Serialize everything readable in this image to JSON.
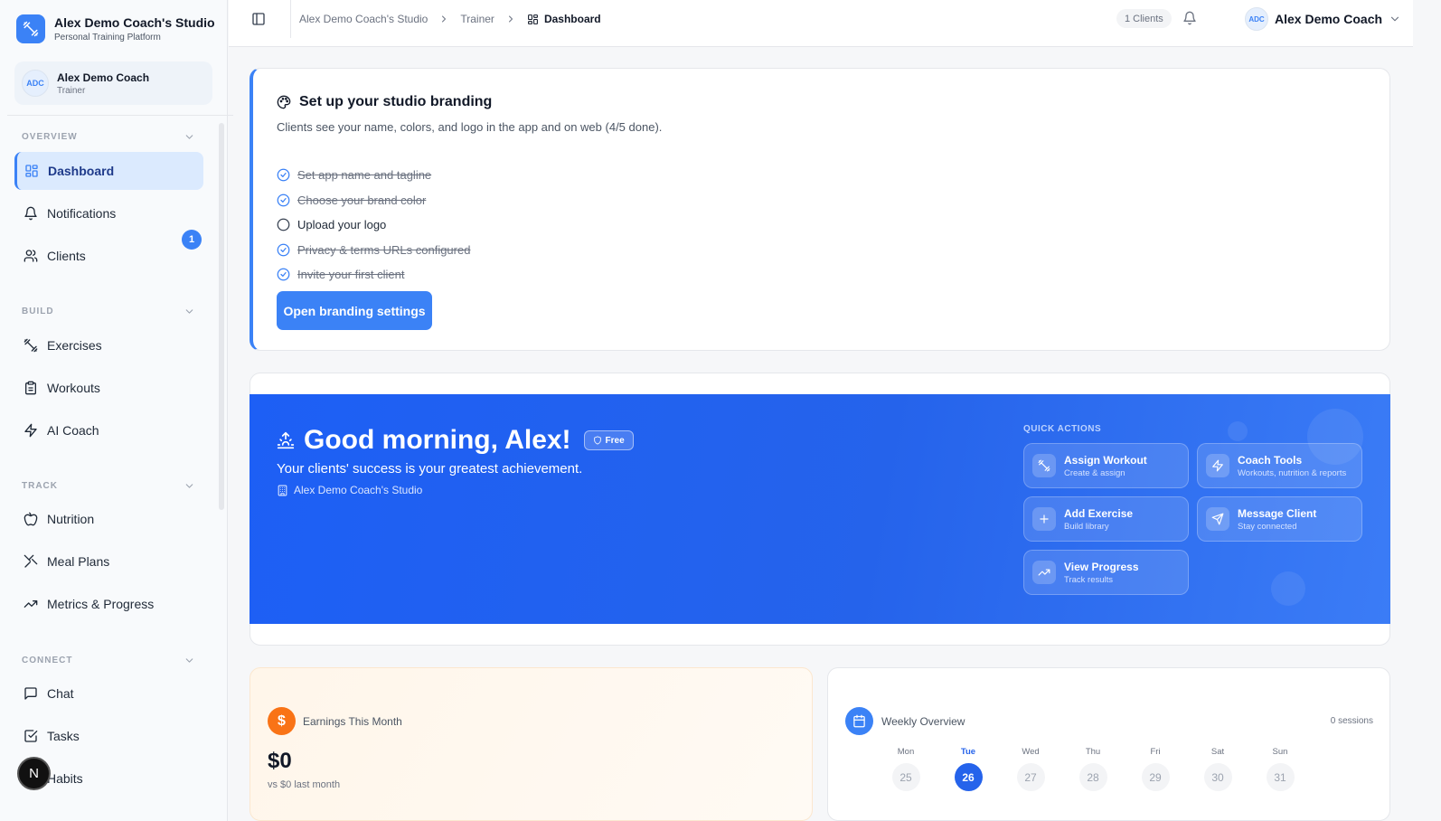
{
  "brand": {
    "title": "Alex Demo Coach's Studio",
    "subtitle": "Personal Training Platform"
  },
  "user": {
    "initials": "ADC",
    "name": "Alex Demo Coach",
    "role": "Trainer"
  },
  "sidebar": {
    "sections": [
      {
        "label": "OVERVIEW",
        "items": [
          {
            "label": "Dashboard",
            "icon": "grid-icon",
            "active": true
          },
          {
            "label": "Notifications",
            "icon": "bell-icon"
          },
          {
            "label": "Clients",
            "icon": "users-icon",
            "badge": "1"
          }
        ]
      },
      {
        "label": "BUILD",
        "items": [
          {
            "label": "Exercises",
            "icon": "dumbbell-icon"
          },
          {
            "label": "Workouts",
            "icon": "clipboard-icon"
          },
          {
            "label": "AI Coach",
            "icon": "bolt-icon"
          }
        ]
      },
      {
        "label": "TRACK",
        "items": [
          {
            "label": "Nutrition",
            "icon": "apple-icon"
          },
          {
            "label": "Meal Plans",
            "icon": "utensils-icon"
          },
          {
            "label": "Metrics & Progress",
            "icon": "trending-up-icon"
          }
        ]
      },
      {
        "label": "CONNECT",
        "items": [
          {
            "label": "Chat",
            "icon": "message-icon"
          },
          {
            "label": "Tasks",
            "icon": "checkbox-icon"
          },
          {
            "label": "Habits",
            "icon": "target-icon"
          }
        ]
      }
    ],
    "floating_button": "N"
  },
  "topbar": {
    "breadcrumbs": [
      "Alex Demo Coach's Studio",
      "Trainer",
      "Dashboard"
    ],
    "clients_pill": "1 Clients",
    "user_initials": "ADC",
    "user_name": "Alex Demo Coach"
  },
  "branding": {
    "title": "Set up your studio branding",
    "subtitle": "Clients see your name, colors, and logo in the app and on web (4/5 done).",
    "checklist": [
      {
        "label": "Set app name and tagline",
        "done": true
      },
      {
        "label": "Choose your brand color",
        "done": true
      },
      {
        "label": "Upload your logo",
        "done": false
      },
      {
        "label": "Privacy & terms URLs configured",
        "done": true
      },
      {
        "label": "Invite your first client",
        "done": true
      }
    ],
    "button_label": "Open branding settings"
  },
  "hero": {
    "greeting": "Good morning, Alex!",
    "plan_badge": "Free",
    "subtitle": "Your clients' success is your greatest achievement.",
    "studio": "Alex Demo Coach's Studio",
    "quick_actions_label": "QUICK ACTIONS",
    "quick_actions": [
      {
        "title": "Assign Workout",
        "subtitle": "Create & assign",
        "icon": "dumbbell-icon"
      },
      {
        "title": "Coach Tools",
        "subtitle": "Workouts, nutrition & reports",
        "icon": "bolt-icon"
      },
      {
        "title": "Add Exercise",
        "subtitle": "Build library",
        "icon": "plus-icon"
      },
      {
        "title": "Message Client",
        "subtitle": "Stay connected",
        "icon": "send-icon"
      },
      {
        "title": "View Progress",
        "subtitle": "Track results",
        "icon": "trending-up-icon"
      }
    ]
  },
  "earnings": {
    "icon_glyph": "$",
    "title": "Earnings This Month",
    "amount": "$0",
    "comparison": "vs $0 last month"
  },
  "weekly": {
    "title": "Weekly Overview",
    "sessions": "0 sessions",
    "days": [
      {
        "name": "Mon",
        "num": "25"
      },
      {
        "name": "Tue",
        "num": "26",
        "today": true
      },
      {
        "name": "Wed",
        "num": "27"
      },
      {
        "name": "Thu",
        "num": "28"
      },
      {
        "name": "Fri",
        "num": "29"
      },
      {
        "name": "Sat",
        "num": "30"
      },
      {
        "name": "Sun",
        "num": "31"
      }
    ]
  },
  "colors": {
    "accent": "#3b82f6",
    "hero": "#2563eb",
    "earnings": "#f97316"
  }
}
